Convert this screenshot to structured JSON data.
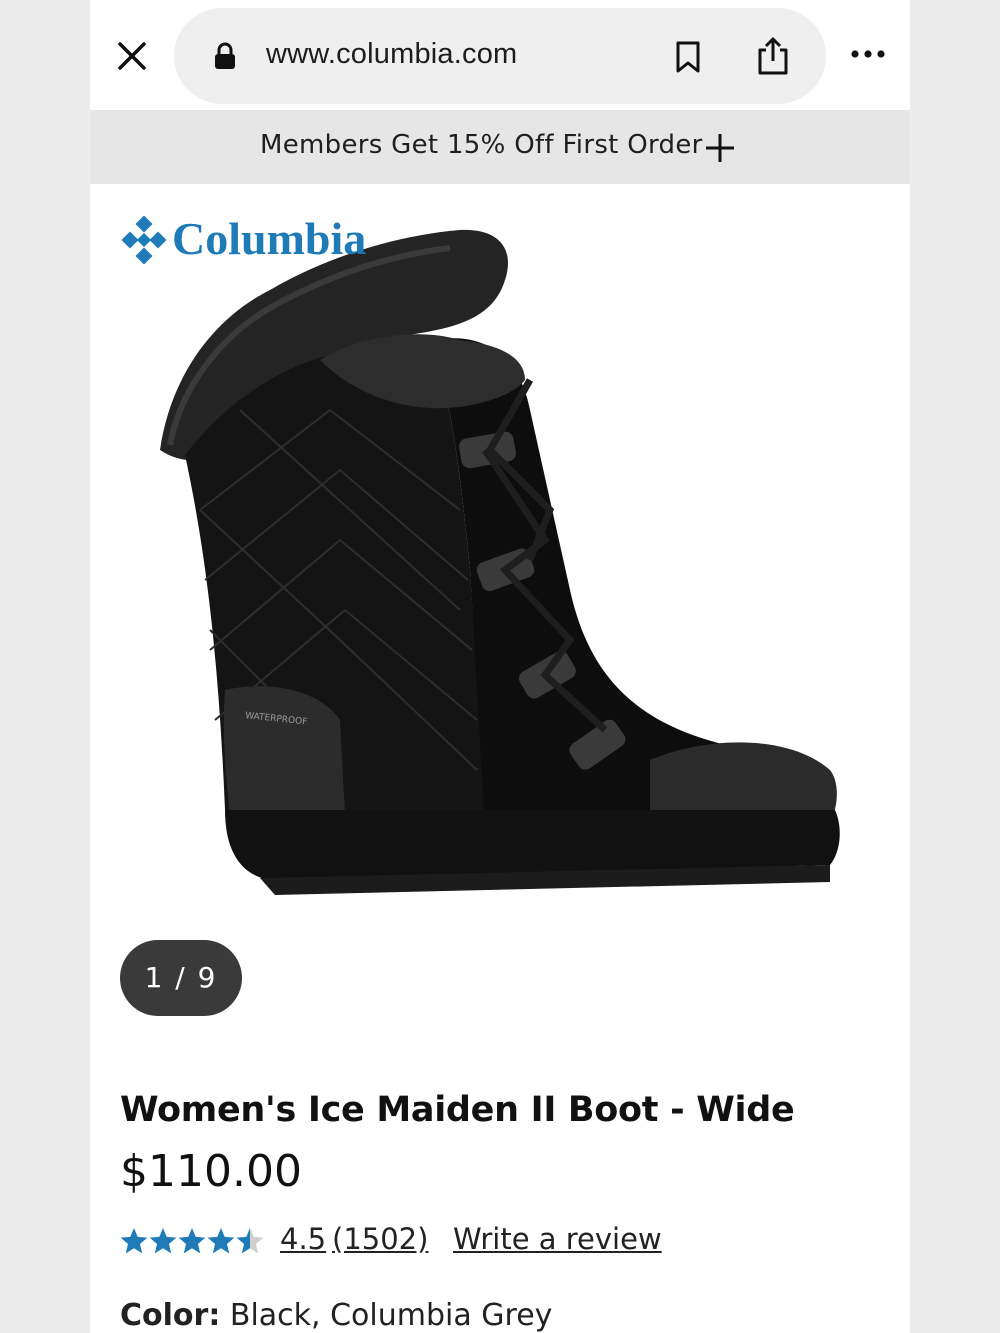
{
  "browser": {
    "url": "www.columbia.com",
    "icons": [
      "close-icon",
      "lock-icon",
      "bookmark-icon",
      "share-icon",
      "more-icon"
    ]
  },
  "promo": {
    "text": "Members Get 15% Off First Order"
  },
  "brand": {
    "name": "Columbia",
    "color": "#1e7bb8"
  },
  "gallery": {
    "counter": "1 / 9"
  },
  "product": {
    "title": "Women's Ice Maiden II Boot - Wide",
    "price": "$110.00",
    "rating": "4.5",
    "rating_value": 4.5,
    "rating_max": 5,
    "review_count": "(1502)",
    "write_review": "Write a review",
    "color_label": "Color:",
    "color_value": "Black, Columbia Grey",
    "star_color": "#1e7bb8"
  }
}
